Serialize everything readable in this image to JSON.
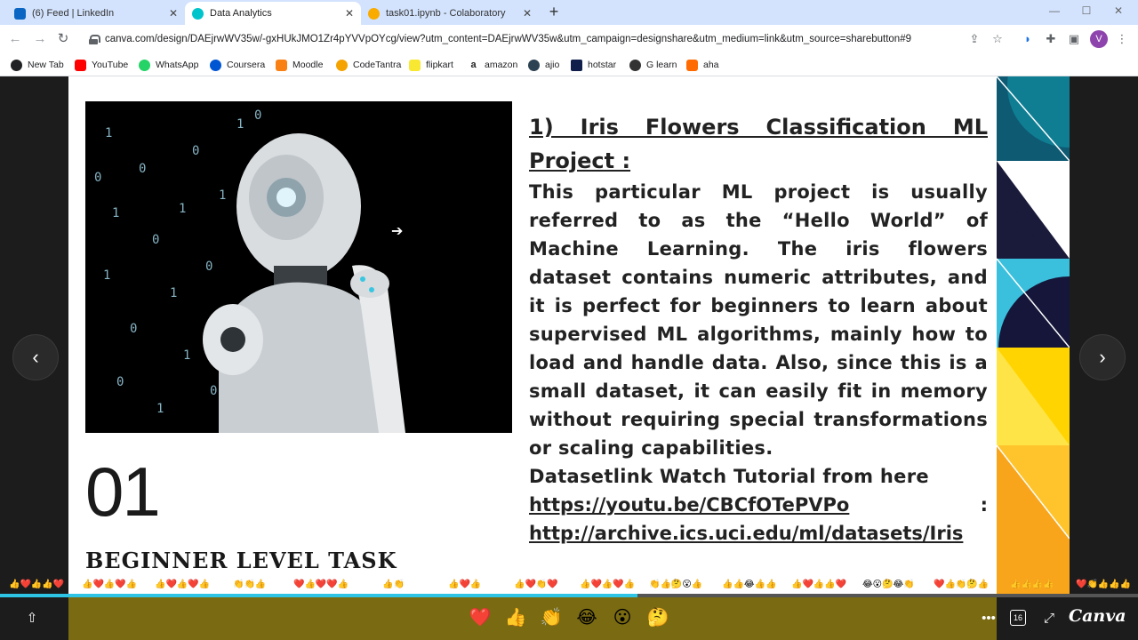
{
  "browser": {
    "tabs": [
      {
        "title": "(6) Feed | LinkedIn",
        "favicon_color": "#0a66c2",
        "active": false
      },
      {
        "title": "Data Analytics",
        "favicon_color": "#00c4cc",
        "active": true
      },
      {
        "title": "task01.ipynb - Colaboratory",
        "favicon_color": "#f9ab00",
        "active": false
      }
    ],
    "url": "canva.com/design/DAEjrwWV35w/-gxHUkJMO1Zr4pYVVpOYcg/view?utm_content=DAEjrwWV35w&utm_campaign=designshare&utm_medium=link&utm_source=sharebutton#9",
    "profile_initial": "V",
    "bookmarks": [
      {
        "label": "New Tab",
        "color": "#5f6368"
      },
      {
        "label": "YouTube",
        "color": "#ff0000"
      },
      {
        "label": "WhatsApp",
        "color": "#25d366"
      },
      {
        "label": "Coursera",
        "color": "#0056d2"
      },
      {
        "label": "Moodle",
        "color": "#f98012"
      },
      {
        "label": "CodeTantra",
        "color": "#f4a300"
      },
      {
        "label": "flipkart",
        "color": "#f8e831"
      },
      {
        "label": "amazon",
        "color": "#222222"
      },
      {
        "label": "ajio",
        "color": "#2c4152"
      },
      {
        "label": "hotstar",
        "color": "#0f1e4a"
      },
      {
        "label": "G learn",
        "color": "#333333"
      },
      {
        "label": "aha",
        "color": "#ff6b00"
      }
    ]
  },
  "slide": {
    "number": "01",
    "level": "BEGINNER LEVEL TASK",
    "heading": "1) Iris Flowers Classification ML Project :",
    "body": "This particular ML project is usually referred to as the “Hello World” of Machine Learning. The iris flowers dataset contains numeric attributes, and it is perfect for beginners to learn about supervised ML algorithms, mainly how to load and handle data. Also, since this is a small dataset, it can easily fit in memory without requiring special transformations or scaling capabilities.",
    "dataset_line": "Datasetlink Watch Tutorial from here",
    "youtube_link": "https://youtu.be/CBCfOTePVPo",
    "colon": ":",
    "dataset_link": "http://archive.ics.uci.edu/ml/datasets/Iris"
  },
  "player": {
    "prev_icon": "‹",
    "next_icon": "›",
    "progress_percent": 56,
    "reactions": [
      "❤️",
      "👍",
      "👏",
      "😂",
      "😮",
      "🤔"
    ],
    "brand": "Canva",
    "page_count": "16"
  }
}
